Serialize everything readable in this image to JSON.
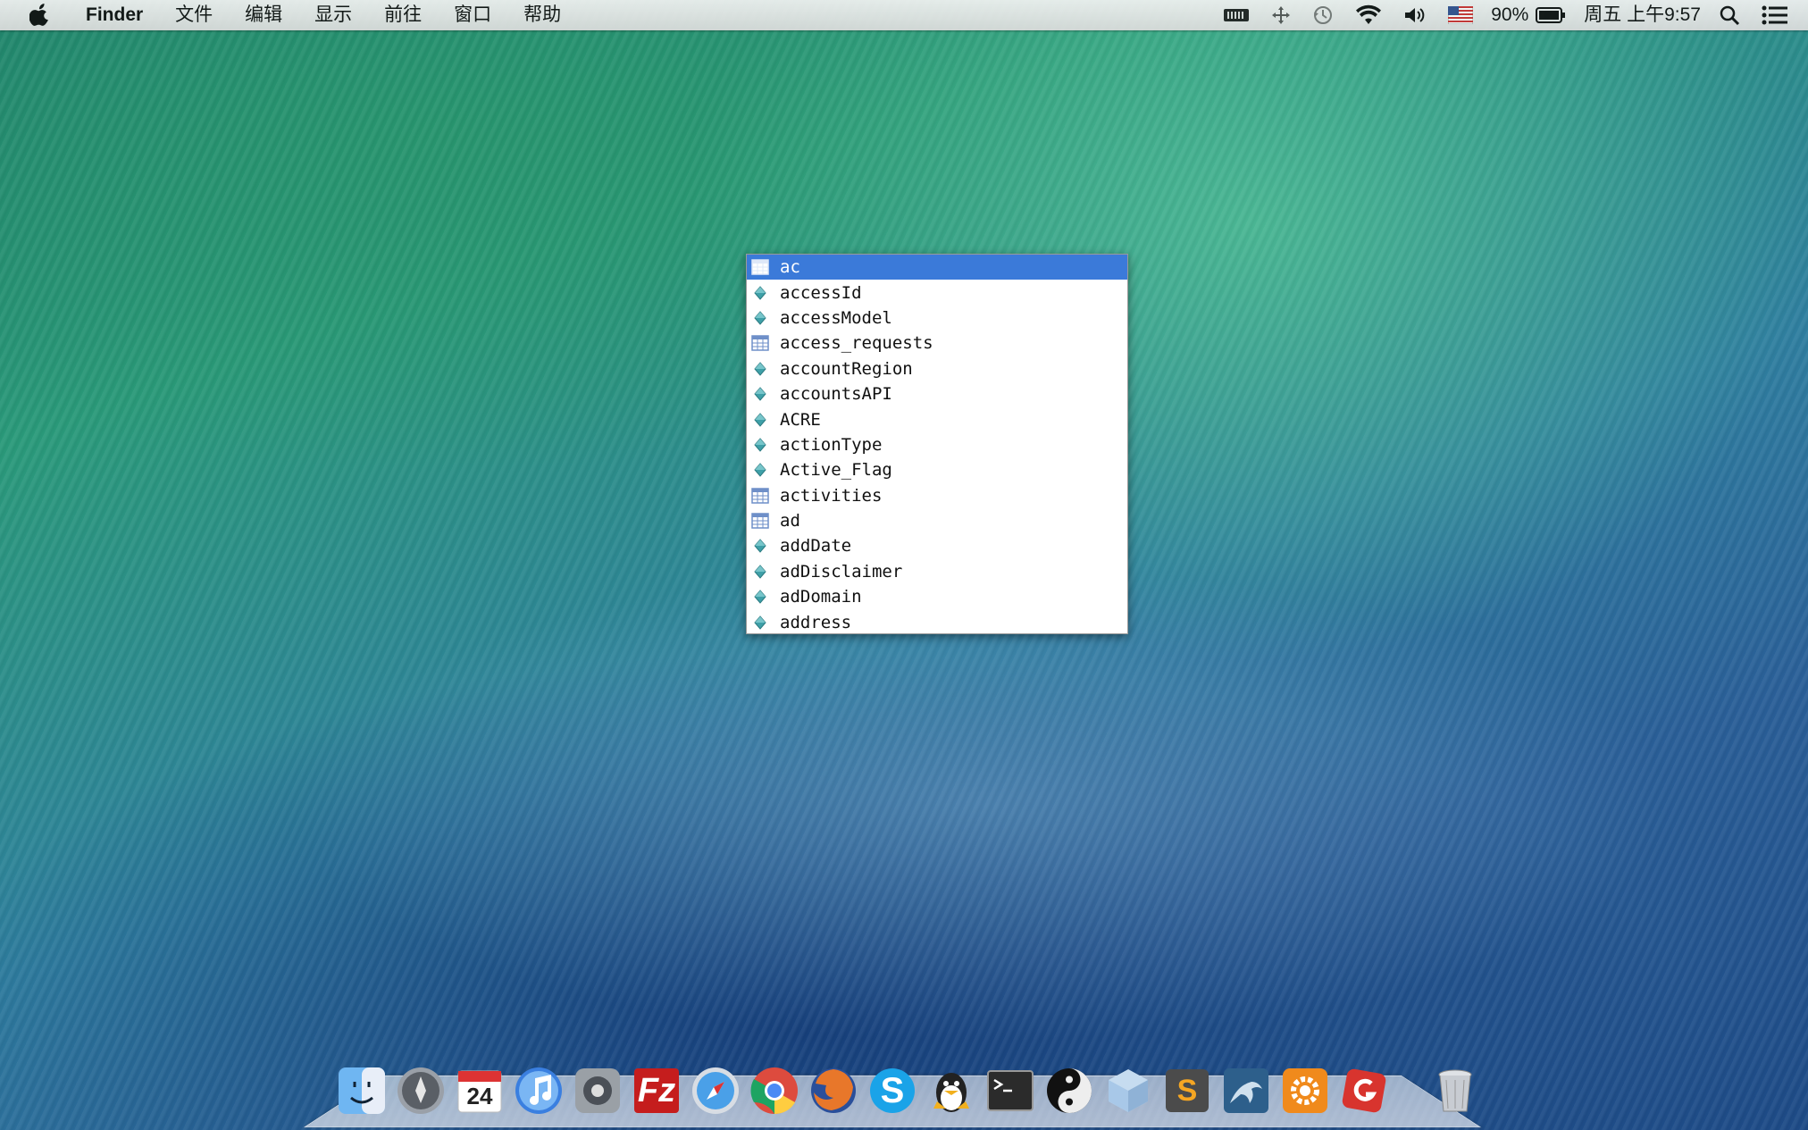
{
  "menubar": {
    "app": "Finder",
    "items": [
      "文件",
      "编辑",
      "显示",
      "前往",
      "窗口",
      "帮助"
    ],
    "battery_percent": "90%",
    "clock": "周五 上午9:57"
  },
  "autocomplete": {
    "selected_index": 0,
    "items": [
      {
        "label": "ac",
        "kind": "table"
      },
      {
        "label": "accessId",
        "kind": "column"
      },
      {
        "label": "accessModel",
        "kind": "column"
      },
      {
        "label": "access_requests",
        "kind": "table"
      },
      {
        "label": "accountRegion",
        "kind": "column"
      },
      {
        "label": "accountsAPI",
        "kind": "column"
      },
      {
        "label": "ACRE",
        "kind": "column"
      },
      {
        "label": "actionType",
        "kind": "column"
      },
      {
        "label": "Active_Flag",
        "kind": "column"
      },
      {
        "label": "activities",
        "kind": "table"
      },
      {
        "label": "ad",
        "kind": "table"
      },
      {
        "label": "addDate",
        "kind": "column"
      },
      {
        "label": "adDisclaimer",
        "kind": "column"
      },
      {
        "label": "adDomain",
        "kind": "column"
      },
      {
        "label": "address",
        "kind": "column"
      }
    ],
    "colors": {
      "selection": "#3b7ad9",
      "table_icon": "#6e8fc8",
      "column_icon": "#3fa0a8"
    }
  },
  "calendar": {
    "day": "24"
  },
  "dock": {
    "apps": [
      {
        "name": "finder-icon",
        "color": "#4a8fe0"
      },
      {
        "name": "launchpad-icon",
        "color": "#8a8f98"
      },
      {
        "name": "calendar-icon",
        "color": "#f4f4f4"
      },
      {
        "name": "itunes-icon",
        "color": "#3a7fe0"
      },
      {
        "name": "system-preferences-icon",
        "color": "#7d8288"
      },
      {
        "name": "filezilla-icon",
        "color": "#c51d1d"
      },
      {
        "name": "safari-icon",
        "color": "#4aa0e8"
      },
      {
        "name": "chrome-icon",
        "color": "#e0e0e0"
      },
      {
        "name": "firefox-icon",
        "color": "#e8772a"
      },
      {
        "name": "skype-icon",
        "color": "#1aa3e8"
      },
      {
        "name": "qq-icon",
        "color": "#222222"
      },
      {
        "name": "terminal-icon",
        "color": "#2b2b2b"
      },
      {
        "name": "yinyang-icon",
        "color": "#eeeeee"
      },
      {
        "name": "cube-app-icon",
        "color": "#a8c8e8"
      },
      {
        "name": "sublime-text-icon",
        "color": "#4b4b4b"
      },
      {
        "name": "mysql-workbench-icon",
        "color": "#2d5f8b"
      },
      {
        "name": "settings-gear-icon",
        "color": "#f08a1c"
      },
      {
        "name": "git-client-icon",
        "color": "#d8342e"
      },
      {
        "name": "trash-icon",
        "color": "#b8bcc2"
      }
    ]
  }
}
